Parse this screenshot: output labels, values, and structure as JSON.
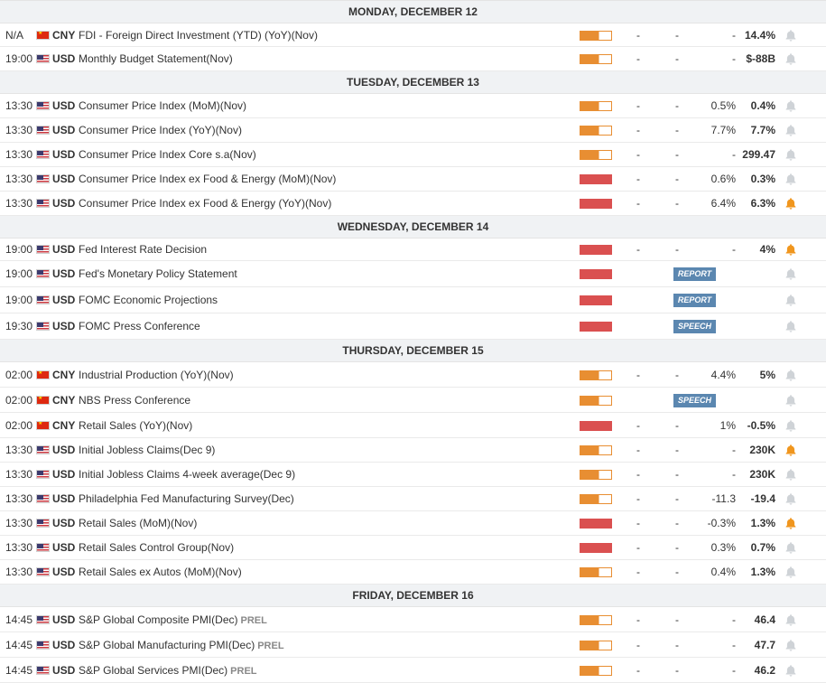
{
  "colors": {
    "medium_impact": "#e88e32",
    "high_impact": "#da5050",
    "badge": "#5b87b0",
    "bell_active": "#f0961e",
    "bell_inactive": "#cfd3d7"
  },
  "days": [
    {
      "label": "MONDAY, DECEMBER 12",
      "events": [
        {
          "time": "N/A",
          "country": "CNY",
          "event": "FDI - Foreign Direct Investment (YTD) (YoY)(Nov)",
          "prel": "",
          "impact": "medium",
          "actual": "-",
          "deviation": "-",
          "consensus": "-",
          "previous": "14.4%",
          "badge": "",
          "alert": false
        },
        {
          "time": "19:00",
          "country": "USD",
          "event": "Monthly Budget Statement(Nov)",
          "prel": "",
          "impact": "medium",
          "actual": "-",
          "deviation": "-",
          "consensus": "-",
          "previous": "$-88B",
          "badge": "",
          "alert": false
        }
      ]
    },
    {
      "label": "TUESDAY, DECEMBER 13",
      "events": [
        {
          "time": "13:30",
          "country": "USD",
          "event": "Consumer Price Index (MoM)(Nov)",
          "prel": "",
          "impact": "medium",
          "actual": "-",
          "deviation": "-",
          "consensus": "0.5%",
          "previous": "0.4%",
          "badge": "",
          "alert": false
        },
        {
          "time": "13:30",
          "country": "USD",
          "event": "Consumer Price Index (YoY)(Nov)",
          "prel": "",
          "impact": "medium",
          "actual": "-",
          "deviation": "-",
          "consensus": "7.7%",
          "previous": "7.7%",
          "badge": "",
          "alert": false
        },
        {
          "time": "13:30",
          "country": "USD",
          "event": "Consumer Price Index Core s.a(Nov)",
          "prel": "",
          "impact": "medium",
          "actual": "-",
          "deviation": "-",
          "consensus": "-",
          "previous": "299.47",
          "badge": "",
          "alert": false
        },
        {
          "time": "13:30",
          "country": "USD",
          "event": "Consumer Price Index ex Food & Energy (MoM)(Nov)",
          "prel": "",
          "impact": "high",
          "actual": "-",
          "deviation": "-",
          "consensus": "0.6%",
          "previous": "0.3%",
          "badge": "",
          "alert": false
        },
        {
          "time": "13:30",
          "country": "USD",
          "event": "Consumer Price Index ex Food & Energy (YoY)(Nov)",
          "prel": "",
          "impact": "high",
          "actual": "-",
          "deviation": "-",
          "consensus": "6.4%",
          "previous": "6.3%",
          "badge": "",
          "alert": true
        }
      ]
    },
    {
      "label": "WEDNESDAY, DECEMBER 14",
      "events": [
        {
          "time": "19:00",
          "country": "USD",
          "event": "Fed Interest Rate Decision",
          "prel": "",
          "impact": "high",
          "actual": "-",
          "deviation": "-",
          "consensus": "-",
          "previous": "4%",
          "badge": "",
          "alert": true
        },
        {
          "time": "19:00",
          "country": "USD",
          "event": "Fed's Monetary Policy Statement",
          "prel": "",
          "impact": "high",
          "actual": "",
          "deviation": "",
          "consensus": "",
          "previous": "",
          "badge": "REPORT",
          "alert": false
        },
        {
          "time": "19:00",
          "country": "USD",
          "event": "FOMC Economic Projections",
          "prel": "",
          "impact": "high",
          "actual": "",
          "deviation": "",
          "consensus": "",
          "previous": "",
          "badge": "REPORT",
          "alert": false
        },
        {
          "time": "19:30",
          "country": "USD",
          "event": "FOMC Press Conference",
          "prel": "",
          "impact": "high",
          "actual": "",
          "deviation": "",
          "consensus": "",
          "previous": "",
          "badge": "SPEECH",
          "alert": false
        }
      ]
    },
    {
      "label": "THURSDAY, DECEMBER 15",
      "events": [
        {
          "time": "02:00",
          "country": "CNY",
          "event": "Industrial Production (YoY)(Nov)",
          "prel": "",
          "impact": "medium",
          "actual": "-",
          "deviation": "-",
          "consensus": "4.4%",
          "previous": "5%",
          "badge": "",
          "alert": false
        },
        {
          "time": "02:00",
          "country": "CNY",
          "event": "NBS Press Conference",
          "prel": "",
          "impact": "medium",
          "actual": "",
          "deviation": "",
          "consensus": "",
          "previous": "",
          "badge": "SPEECH",
          "alert": false
        },
        {
          "time": "02:00",
          "country": "CNY",
          "event": "Retail Sales (YoY)(Nov)",
          "prel": "",
          "impact": "high",
          "actual": "-",
          "deviation": "-",
          "consensus": "1%",
          "previous": "-0.5%",
          "badge": "",
          "alert": false
        },
        {
          "time": "13:30",
          "country": "USD",
          "event": "Initial Jobless Claims(Dec 9)",
          "prel": "",
          "impact": "medium",
          "actual": "-",
          "deviation": "-",
          "consensus": "-",
          "previous": "230K",
          "badge": "",
          "alert": true
        },
        {
          "time": "13:30",
          "country": "USD",
          "event": "Initial Jobless Claims 4-week average(Dec 9)",
          "prel": "",
          "impact": "medium",
          "actual": "-",
          "deviation": "-",
          "consensus": "-",
          "previous": "230K",
          "badge": "",
          "alert": false
        },
        {
          "time": "13:30",
          "country": "USD",
          "event": "Philadelphia Fed Manufacturing Survey(Dec)",
          "prel": "",
          "impact": "medium",
          "actual": "-",
          "deviation": "-",
          "consensus": "-11.3",
          "previous": "-19.4",
          "badge": "",
          "alert": false
        },
        {
          "time": "13:30",
          "country": "USD",
          "event": "Retail Sales (MoM)(Nov)",
          "prel": "",
          "impact": "high",
          "actual": "-",
          "deviation": "-",
          "consensus": "-0.3%",
          "previous": "1.3%",
          "badge": "",
          "alert": true
        },
        {
          "time": "13:30",
          "country": "USD",
          "event": "Retail Sales Control Group(Nov)",
          "prel": "",
          "impact": "high",
          "actual": "-",
          "deviation": "-",
          "consensus": "0.3%",
          "previous": "0.7%",
          "badge": "",
          "alert": false
        },
        {
          "time": "13:30",
          "country": "USD",
          "event": "Retail Sales ex Autos (MoM)(Nov)",
          "prel": "",
          "impact": "medium",
          "actual": "-",
          "deviation": "-",
          "consensus": "0.4%",
          "previous": "1.3%",
          "badge": "",
          "alert": false
        }
      ]
    },
    {
      "label": "FRIDAY, DECEMBER 16",
      "events": [
        {
          "time": "14:45",
          "country": "USD",
          "event": "S&P Global Composite PMI(Dec)",
          "prel": "PREL",
          "impact": "medium",
          "actual": "-",
          "deviation": "-",
          "consensus": "-",
          "previous": "46.4",
          "badge": "",
          "alert": false
        },
        {
          "time": "14:45",
          "country": "USD",
          "event": "S&P Global Manufacturing PMI(Dec)",
          "prel": "PREL",
          "impact": "medium",
          "actual": "-",
          "deviation": "-",
          "consensus": "-",
          "previous": "47.7",
          "badge": "",
          "alert": false
        },
        {
          "time": "14:45",
          "country": "USD",
          "event": "S&P Global Services PMI(Dec)",
          "prel": "PREL",
          "impact": "medium",
          "actual": "-",
          "deviation": "-",
          "consensus": "-",
          "previous": "46.2",
          "badge": "",
          "alert": false
        }
      ]
    }
  ]
}
